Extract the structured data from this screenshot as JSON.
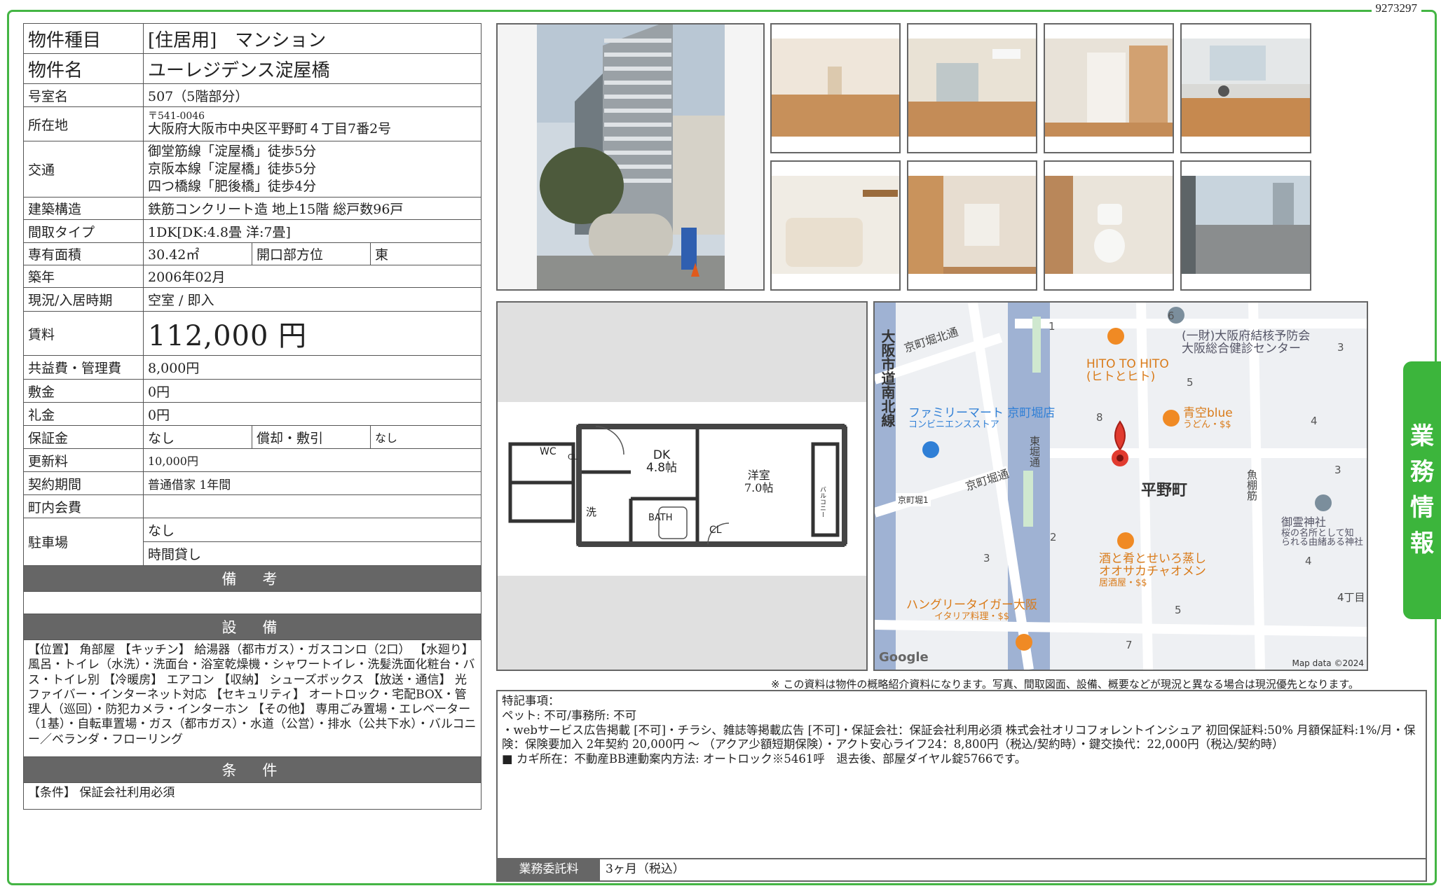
{
  "doc_number": "9273297",
  "side_tab": [
    "業",
    "務",
    "情",
    "報"
  ],
  "spec": {
    "type_label": "物件種目",
    "type_value": "[住居用]　マンション",
    "name_label": "物件名",
    "name_value": "ユーレジデンス淀屋橋",
    "room_label": "号室名",
    "room_value": "507（5階部分）",
    "address_label": "所在地",
    "postal": "〒541-0046",
    "address": "大阪府大阪市中央区平野町４丁目7番2号",
    "transport_label": "交通",
    "transport": [
      "御堂筋線「淀屋橋」徒歩5分",
      "京阪本線「淀屋橋」徒歩5分",
      "四つ橋線「肥後橋」徒歩4分"
    ],
    "structure_label": "建築構造",
    "structure_value": "鉄筋コンクリート造 地上15階 総戸数96戸",
    "layout_label": "間取タイプ",
    "layout_value": "1DK[DK:4.8畳 洋:7畳]",
    "area_label": "専有面積",
    "area_value": "30.42㎡",
    "facing_label": "開口部方位",
    "facing_value": "東",
    "built_label": "築年",
    "built_value": "2006年02月",
    "status_label": "現況/入居時期",
    "status_value": "空室 / 即入",
    "rent_label": "賃料",
    "rent_value": "112,000 円",
    "common_label": "共益費・管理費",
    "common_value": "8,000円",
    "deposit_label": "敷金",
    "deposit_value": "0円",
    "key_money_label": "礼金",
    "key_money_value": "0円",
    "guarantee_label": "保証金",
    "guarantee_value": "なし",
    "amort_label": "償却・敷引",
    "amort_value": "なし",
    "renewal_label": "更新料",
    "renewal_value": "10,000円",
    "contract_label": "契約期間",
    "contract_value": "普通借家 1年間",
    "town_fee_label": "町内会費",
    "town_fee_value": "",
    "parking_label": "駐車場",
    "parking_value1": "なし",
    "parking_value2": "時間貸し",
    "remarks_header": "備　考",
    "equipment_header": "設　備",
    "equipment_text": "【位置】 角部屋 【キッチン】 給湯器（都市ガス）・ガスコンロ（2口） 【水廻り】 風呂・トイレ（水洗）・洗面台・浴室乾燥機・シャワートイレ・洗髪洗面化粧台・バス・トイレ別 【冷暖房】 エアコン 【収納】 シューズボックス 【放送・通信】 光ファイバー・インターネット対応 【セキュリティ】 オートロック・宅配BOX・管理人（巡回）・防犯カメラ・インターホン 【その他】 専用ごみ置場・エレベーター（1基）・自転車置場・ガス（都市ガス）・水道（公営）・排水（公共下水）・バルコニー／ベランダ・フローリング",
    "conditions_header": "条　件",
    "conditions_text": "【条件】 保証会社利用必須"
  },
  "floorplan": {
    "wc": "WC",
    "cl": "CL",
    "wash": "洗",
    "bath": "BATH",
    "dk": "DK",
    "dk_size": "4.8帖",
    "western": "洋室",
    "western_size": "7.0帖",
    "balcony": "バルコニー",
    "cl2": "CL"
  },
  "map": {
    "labels": {
      "station": "平野町",
      "shop1": "HITO TO HITO",
      "shop1b": "(ヒトとヒト)",
      "shop2": "青空blue",
      "shop2b": "うどん・$$",
      "shop3": "酒と肴とせいろ蒸し",
      "shop3b": "オオサカチャオメン",
      "shop3c": "居酒屋・$$",
      "shop4": "ハングリータイガー大阪",
      "shop4b": "イタリア料理・$$",
      "famima": "ファミリーマート 京町堀店",
      "famima_b": "コンビニエンスストア",
      "clinic": "(一財)大阪府結核予防会",
      "clinic_b": "大阪総合健診センター",
      "shrine": "御霊神社",
      "shrine_b": "桜の名所として知",
      "shrine_c": "られる由緒ある神社",
      "road1": "大阪市道南北線",
      "road2": "京町堀北通",
      "road3": "京町堀通",
      "road4": "東堀通",
      "road5": "魚棚筋",
      "sign": "京町堀1",
      "block": "4丁目",
      "google": "Google",
      "copyright": "Map data ©2024"
    },
    "numbers": [
      "1",
      "6",
      "3",
      "5",
      "8",
      "4",
      "3",
      "2",
      "3",
      "4",
      "5",
      "7"
    ]
  },
  "disclaimer": "※ この資料は物件の概略紹介資料になります。写真、間取図面、設備、概要などが現況と異なる場合は現況優先となります。",
  "remarks": {
    "title": "特記事項：",
    "line1": "ペット: 不可/事務所: 不可",
    "line2": "・webサービス広告掲載 [不可]・チラシ、雑誌等掲載広告 [不可]・保証会社：保証会社利用必須 株式会社オリコフォレントインシュア 初回保証料:50% 月額保証料:1%/月・保険：保険要加入 2年契約 20,000円 ～ （アクア少額短期保険）・アクト安心ライフ24：8,800円（税込/契約時）・鍵交換代：22,000円（税込/契約時）",
    "line3": "■ カギ所在：不動産BB連動案内方法: オートロック※5461呼　退去後、部屋ダイヤル錠5766です。",
    "fee_label": "業務委託料",
    "fee_value": "3ヶ月（税込）"
  }
}
